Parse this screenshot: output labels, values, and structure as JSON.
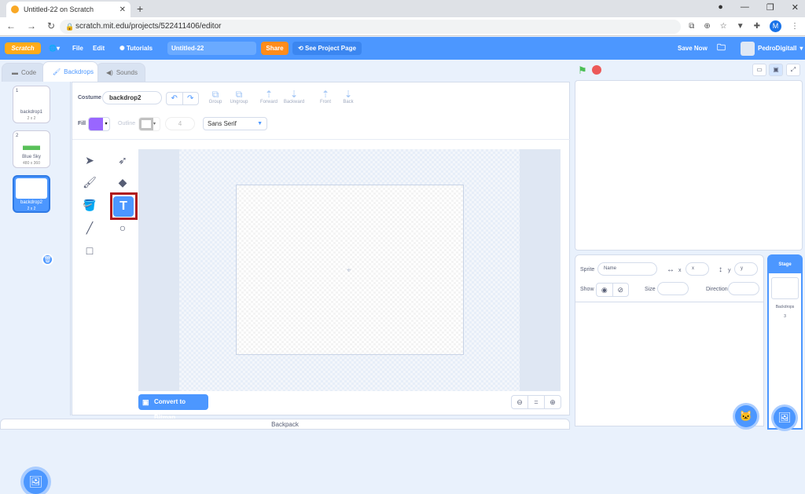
{
  "browser": {
    "tab_title": "Untitled-22 on Scratch",
    "url": "scratch.mit.edu/projects/522411406/editor",
    "profile_initial": "M"
  },
  "menubar": {
    "logo": "Scratch",
    "file": "File",
    "edit": "Edit",
    "tutorials": "Tutorials",
    "project_title": "Untitled-22",
    "share": "Share",
    "see_project_page": "See Project Page",
    "save_now": "Save Now",
    "username": "PedroDigitall"
  },
  "editor_tabs": [
    "Code",
    "Backdrops",
    "Sounds"
  ],
  "backdrops": [
    {
      "num": "1",
      "name": "backdrop1",
      "size": "2 x 2"
    },
    {
      "num": "2",
      "name": "Blue Sky",
      "size": "480 x 360"
    },
    {
      "num": "3",
      "name": "backdrop2",
      "size": "2 x 2"
    }
  ],
  "paint": {
    "costume_label": "Costume",
    "costume_name": "backdrop2",
    "group": "Group",
    "ungroup": "Ungroup",
    "forward": "Forward",
    "backward": "Backward",
    "front": "Front",
    "back": "Back",
    "fill_label": "Fill",
    "outline_label": "Outline",
    "outline_width": "4",
    "font": "Sans Serif",
    "convert_button": "Convert to Bitmap",
    "fill_color": "#9966ff",
    "selected_tool": "text"
  },
  "sprite_info": {
    "sprite_label": "Sprite",
    "name_placeholder": "Name",
    "x_label": "x",
    "x_placeholder": "x",
    "y_label": "y",
    "y_placeholder": "y",
    "show_label": "Show",
    "size_label": "Size",
    "direction_label": "Direction"
  },
  "stage_panel": {
    "header": "Stage",
    "backdrops_label": "Backdrops",
    "backdrops_count": "3"
  },
  "backpack": "Backpack",
  "colors": {
    "accent": "#4c97ff",
    "share": "#ff8c1a",
    "highlight": "#b0191e"
  }
}
